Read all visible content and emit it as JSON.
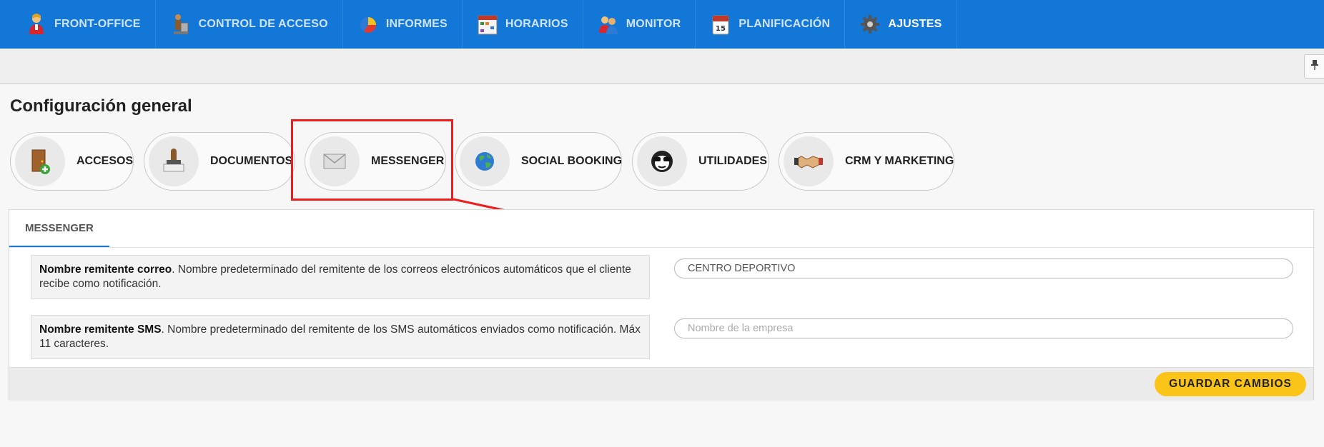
{
  "topnav": {
    "items": [
      {
        "label": "FRONT-OFFICE",
        "icon": "person-icon"
      },
      {
        "label": "CONTROL DE ACCESO",
        "icon": "turnstile-icon"
      },
      {
        "label": "INFORMES",
        "icon": "pie-chart-icon"
      },
      {
        "label": "HORARIOS",
        "icon": "calendar-grid-icon"
      },
      {
        "label": "MONITOR",
        "icon": "people-icon"
      },
      {
        "label": "PLANIFICACIÓN",
        "icon": "calendar-icon"
      },
      {
        "label": "AJUSTES",
        "icon": "gear-icon",
        "active": true
      }
    ]
  },
  "page_title": "Configuración general",
  "settings_pills": [
    {
      "label": "ACCESOS",
      "icon": "door-icon"
    },
    {
      "label": "DOCUMENTOS",
      "icon": "stamp-icon"
    },
    {
      "label": "MESSENGER",
      "icon": "envelope-icon",
      "selected": true
    },
    {
      "label": "SOCIAL BOOKING",
      "icon": "globe-icon"
    },
    {
      "label": "UTILIDADES",
      "icon": "sunglasses-face-icon"
    },
    {
      "label": "CRM Y MARKETING",
      "icon": "handshake-icon"
    }
  ],
  "panel": {
    "tab_label": "MESSENGER",
    "rows": [
      {
        "title": "Nombre remitente correo",
        "description": ". Nombre predeterminado del remitente de los correos electrónicos automáticos que el cliente recibe como notificación.",
        "value": "CENTRO DEPORTIVO",
        "placeholder": ""
      },
      {
        "title": "Nombre remitente SMS",
        "description": ". Nombre predeterminado del remitente de los SMS automáticos enviados como notificación. Máx 11 caracteres.",
        "value": "",
        "placeholder": "Nombre de la empresa"
      }
    ],
    "save_label": "GUARDAR CAMBIOS"
  },
  "colors": {
    "nav_blue": "#1377d8",
    "accent_yellow": "#fbc419",
    "annotation_red": "#ee1c1c"
  }
}
